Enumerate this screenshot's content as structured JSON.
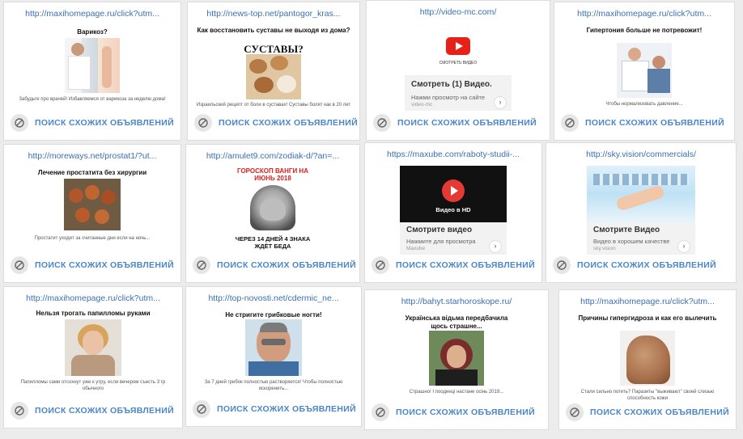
{
  "footer": {
    "similar_label": "ПОИСК СХОЖИХ ОБЪЯВЛЕНИЙ"
  },
  "cards": [
    {
      "url": "http://maxihomepage.ru/click?utm...",
      "headline": "Варикоз?",
      "desc": "Забудьте про врачей! Избавляемся от варикоза за неделю дома!"
    },
    {
      "url": "http://news-top.net/pantogor_kras...",
      "headline": "Как восстановить суставы не выходя из дома?",
      "caption": "СУСТАВЫ?",
      "desc": "Израильский рецепт от боли в суставах! Суставы болят как в 20 лет"
    },
    {
      "url": "http://video-mc.com/",
      "video_title": "Смотреть (1) Видео.",
      "video_sub": "Нажми просмотр на сайте",
      "video_domain": "video-mc",
      "play_label": "СМОТРЕТЬ ВИДЕО",
      "arrow": "›"
    },
    {
      "url": "http://maxihomepage.ru/click?utm...",
      "headline": "Гипертония больше не потревожит!",
      "desc": "Чтобы нормализовать давление..."
    },
    {
      "url": "http://moreways.net/prostat1/?ut...",
      "headline": "Лечение простатита без хирургии",
      "desc": "Простатит уходит за считанные дни если на ночь..."
    },
    {
      "url": "http://amulet9.com/zodiak-d/?an=...",
      "top_text": "ГОРОСКОП ВАНГИ НА ИЮНЬ 2018",
      "bottom_text": "ЧЕРЕЗ 14 ДНЕЙ 4 ЗНАКА ЖДЁТ БЕДА"
    },
    {
      "url": "https://maxube.com/raboty-studii-...",
      "video_title": "Смотрите видео",
      "video_sub": "Нажмите для просмотра",
      "video_domain": "Maxube",
      "banner_text": "Видео в HD",
      "arrow": "›"
    },
    {
      "url": "http://sky.vision/commercials/",
      "video_title": "Смотрите Видео",
      "video_sub": "Видео в хорошем качестве",
      "video_domain": "sky.vision",
      "arrow": "›"
    },
    {
      "url": "http://maxihomepage.ru/click?utm...",
      "headline": "Нельзя трогать папилломы руками",
      "desc": "Папилломы сами отсохнут уже к утру, если вечером съесть 3 гр обычного"
    },
    {
      "url": "http://top-novosti.net/cdermic_ne...",
      "headline": "Не стригите грибковые ногти!",
      "desc": "За 7 дней грибок полностью растворяется! Чтобы полностью искоренить..."
    },
    {
      "url": "http://bahyt.starhoroskope.ru/",
      "headline": "Українська відьма передбачила щось страшне...",
      "desc": "Страшно! І поодинці настане осінь 2019..."
    },
    {
      "url": "http://maxihomepage.ru/click?utm...",
      "headline": "Причины гипергидроза и как его вылечить",
      "desc": "Стали сильно потеть? Паразиты \"выживают\" своей слизью способность кожи"
    }
  ]
}
